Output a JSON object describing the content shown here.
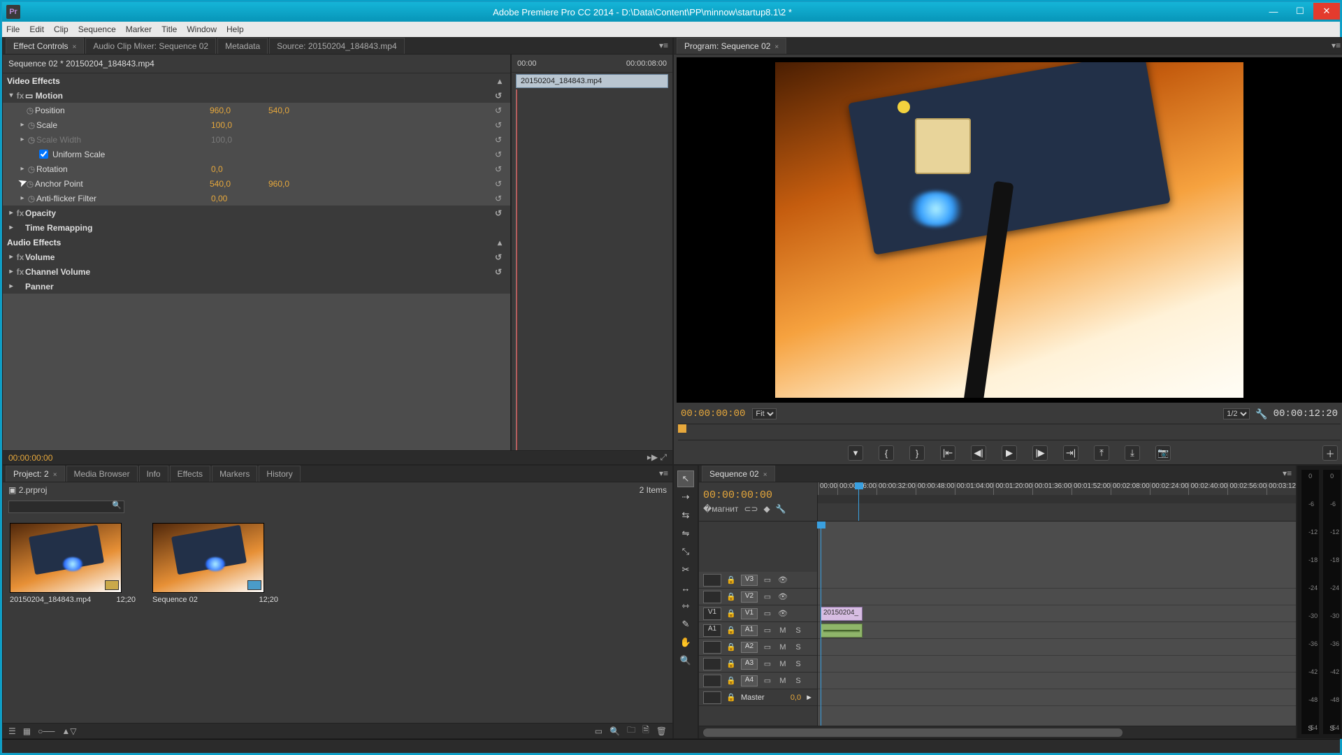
{
  "title": "Adobe Premiere Pro CC 2014 - D:\\Data\\Content\\PP\\minnow\\startup8.1\\2 *",
  "menus": [
    "File",
    "Edit",
    "Clip",
    "Sequence",
    "Marker",
    "Title",
    "Window",
    "Help"
  ],
  "effectControls": {
    "tabs": [
      "Effect Controls",
      "Audio Clip Mixer: Sequence 02",
      "Metadata",
      "Source: 20150204_184843.mp4"
    ],
    "sequenceLine": "Sequence 02 * 20150204_184843.mp4",
    "scaleLeft": "00:00",
    "scaleRight": "00:00:08:00",
    "clipBar": "20150204_184843.mp4",
    "videoEffects": "Video Effects",
    "motion": "Motion",
    "position": "Position",
    "positionX": "960,0",
    "positionY": "540,0",
    "scale": "Scale",
    "scaleVal": "100,0",
    "scaleWidth": "Scale Width",
    "scaleWidthVal": "100,0",
    "uniform": "Uniform Scale",
    "rotation": "Rotation",
    "rotationVal": "0,0",
    "anchor": "Anchor Point",
    "anchorX": "540,0",
    "anchorY": "960,0",
    "antiflicker": "Anti-flicker Filter",
    "antiflickerVal": "0,00",
    "opacity": "Opacity",
    "timeremap": "Time Remapping",
    "audioEffects": "Audio Effects",
    "volume": "Volume",
    "channelVolume": "Channel Volume",
    "panner": "Panner",
    "footerTime": "00:00:00:00"
  },
  "program": {
    "tab": "Program: Sequence 02",
    "current": "00:00:00:00",
    "fit": "Fit",
    "zoom": "1/2",
    "duration": "00:00:12:20"
  },
  "project": {
    "tabs": [
      "Project: 2",
      "Media Browser",
      "Info",
      "Effects",
      "Markers",
      "History"
    ],
    "binName": "2.prproj",
    "itemCount": "2 Items",
    "items": [
      {
        "name": "20150204_184843.mp4",
        "dur": "12;20"
      },
      {
        "name": "Sequence 02",
        "dur": "12;20"
      }
    ]
  },
  "timeline": {
    "tab": "Sequence 02",
    "tc": "00:00:00:00",
    "ruler": [
      "00:00",
      "00:00:16:00",
      "00:00:32:00",
      "00:00:48:00",
      "00:01:04:00",
      "00:01:20:00",
      "00:01:36:00",
      "00:01:52:00",
      "00:02:08:00",
      "00:02:24:00",
      "00:02:40:00",
      "00:02:56:00",
      "00:03:12"
    ],
    "videoTracks": [
      "V3",
      "V2",
      "V1"
    ],
    "audioTracks": [
      "A1",
      "A2",
      "A3",
      "A4"
    ],
    "patchV": "V1",
    "patchA": "A1",
    "master": "Master",
    "masterVal": "0,0",
    "clipName": "20150204_"
  },
  "meters": {
    "ticks": [
      "0",
      "-6",
      "-12",
      "-18",
      "-24",
      "-30",
      "-36",
      "-42",
      "-48",
      "-54"
    ],
    "s": "S"
  }
}
